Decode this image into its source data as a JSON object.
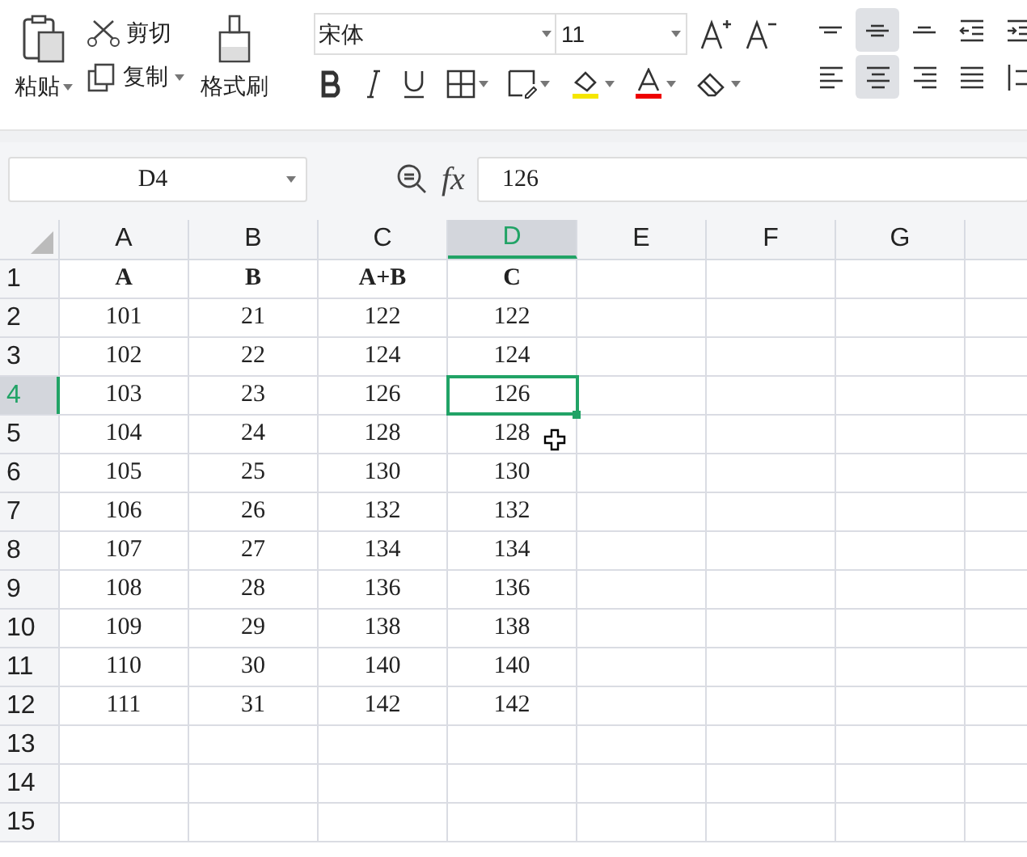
{
  "clipboard": {
    "paste": "粘贴",
    "cut": "剪切",
    "copy": "复制",
    "format_painter": "格式刷"
  },
  "font": {
    "name": "宋体",
    "size": "11"
  },
  "alignment": [
    {
      "kind": "top",
      "selected": false
    },
    {
      "kind": "middle",
      "selected": true
    },
    {
      "kind": "bottom",
      "selected": false
    },
    {
      "kind": "outdent",
      "selected": false
    },
    {
      "kind": "indent",
      "selected": false
    },
    {
      "kind": "left",
      "selected": false
    },
    {
      "kind": "center",
      "selected": true
    },
    {
      "kind": "right",
      "selected": false
    },
    {
      "kind": "justify",
      "selected": false
    },
    {
      "kind": "distribute",
      "selected": false
    }
  ],
  "formula_bar": {
    "name_box": "D4",
    "function_label": "fx",
    "value": "126"
  },
  "columns": [
    {
      "label": "A",
      "selected": false
    },
    {
      "label": "B",
      "selected": false
    },
    {
      "label": "C",
      "selected": false
    },
    {
      "label": "D",
      "selected": true
    },
    {
      "label": "E",
      "selected": false
    },
    {
      "label": "F",
      "selected": false
    },
    {
      "label": "G",
      "selected": false
    }
  ],
  "rows": [
    {
      "label": "1",
      "selected": false,
      "cells": [
        "A",
        "B",
        "A+B",
        "C"
      ]
    },
    {
      "label": "2",
      "selected": false,
      "cells": [
        "101",
        "21",
        "122",
        "122"
      ]
    },
    {
      "label": "3",
      "selected": false,
      "cells": [
        "102",
        "22",
        "124",
        "124"
      ]
    },
    {
      "label": "4",
      "selected": true,
      "cells": [
        "103",
        "23",
        "126"
      ],
      "active_cell": "126"
    },
    {
      "label": "5",
      "selected": false,
      "cells": [
        "104",
        "24",
        "128",
        "128"
      ]
    },
    {
      "label": "6",
      "selected": false,
      "cells": [
        "105",
        "25",
        "130",
        "130"
      ]
    },
    {
      "label": "7",
      "selected": false,
      "cells": [
        "106",
        "26",
        "132",
        "132"
      ]
    },
    {
      "label": "8",
      "selected": false,
      "cells": [
        "107",
        "27",
        "134",
        "134"
      ]
    },
    {
      "label": "9",
      "selected": false,
      "cells": [
        "108",
        "28",
        "136",
        "136"
      ]
    },
    {
      "label": "10",
      "selected": false,
      "cells": [
        "109",
        "29",
        "138",
        "138"
      ]
    },
    {
      "label": "11",
      "selected": false,
      "cells": [
        "110",
        "30",
        "140",
        "140"
      ]
    },
    {
      "label": "12",
      "selected": false,
      "cells": [
        "111",
        "31",
        "142",
        "142"
      ]
    },
    {
      "label": "13",
      "selected": false,
      "cells": []
    },
    {
      "label": "14",
      "selected": false,
      "cells": []
    },
    {
      "label": "15",
      "selected": false,
      "cells": []
    }
  ]
}
